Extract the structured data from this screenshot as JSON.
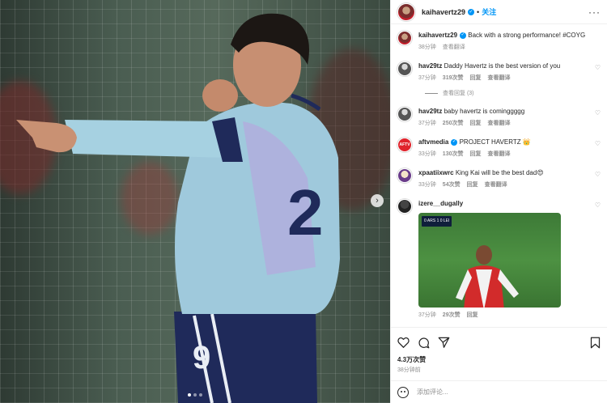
{
  "post": {
    "username": "kaihavertz29",
    "follow_label": "关注",
    "more_label": "···"
  },
  "caption": {
    "username": "kaihavertz29",
    "text": "Back with a strong performance! #COYG",
    "time": "38分钟",
    "translate": "查看翻译"
  },
  "comments": [
    {
      "username": "hav29tz",
      "text": "Daddy Havertz is the best version of you",
      "time": "37分钟",
      "likes": "319次赞",
      "reply": "回复",
      "translate": "查看翻译",
      "avatar_class": "ava-hav"
    },
    {
      "username": "hav29tz",
      "text": "baby havertz is cominggggg",
      "time": "37分钟",
      "likes": "250次赞",
      "reply": "回复",
      "translate": "查看翻译",
      "avatar_class": "ava-hav"
    },
    {
      "username": "aftvmedia",
      "text": "PROJECT HAVERTZ 👑",
      "time": "33分钟",
      "likes": "130次赞",
      "reply": "回复",
      "translate": "查看翻译",
      "avatar_label": "AFTV"
    },
    {
      "username": "xpaatiixwrc",
      "text": "King Kai will be the best dad😍",
      "time": "33分钟",
      "likes": "54次赞",
      "reply": "回复",
      "translate": "查看翻译"
    },
    {
      "username": "izere__dugally",
      "time": "37分钟",
      "likes": "29次赞",
      "reply": "回复",
      "gif_score": "0 ARS 1 0 LEI"
    }
  ],
  "view_replies": "查看回复 (3)",
  "actions": {
    "likes": "4.3万次赞",
    "posted_ago": "38分钟前",
    "add_comment_placeholder": "添加评论..."
  },
  "icons": [
    "heart-icon",
    "comment-icon",
    "share-icon",
    "bookmark-icon",
    "emoji-icon",
    "chevron-right-icon",
    "verified-icon"
  ]
}
